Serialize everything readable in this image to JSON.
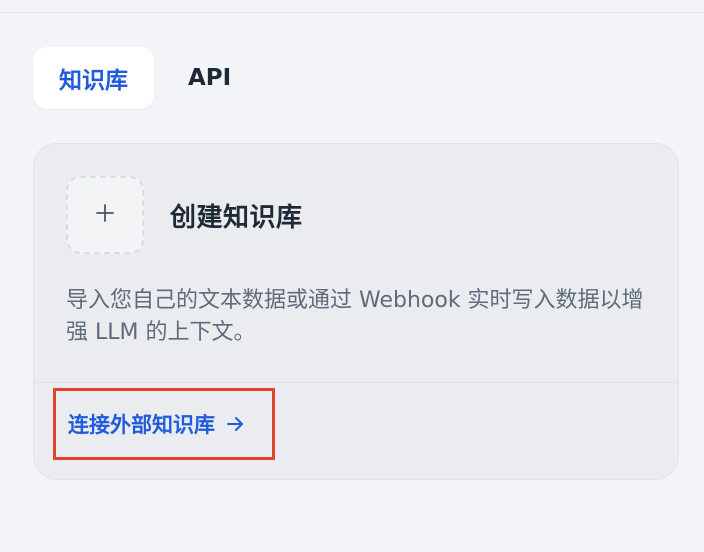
{
  "tabs": [
    {
      "label": "知识库",
      "active": true
    },
    {
      "label": "API",
      "active": false
    }
  ],
  "create_card": {
    "icon": "plus-icon",
    "title": "创建知识库",
    "description": "导入您自己的文本数据或通过 Webhook 实时写入数据以增强 LLM 的上下文。",
    "link_label": "连接外部知识库",
    "link_icon": "arrow-right-icon"
  },
  "colors": {
    "accent": "#1f5bdb",
    "highlight_border": "#e0432c",
    "background": "#f2f4f7",
    "card_background": "#eaecf0"
  }
}
